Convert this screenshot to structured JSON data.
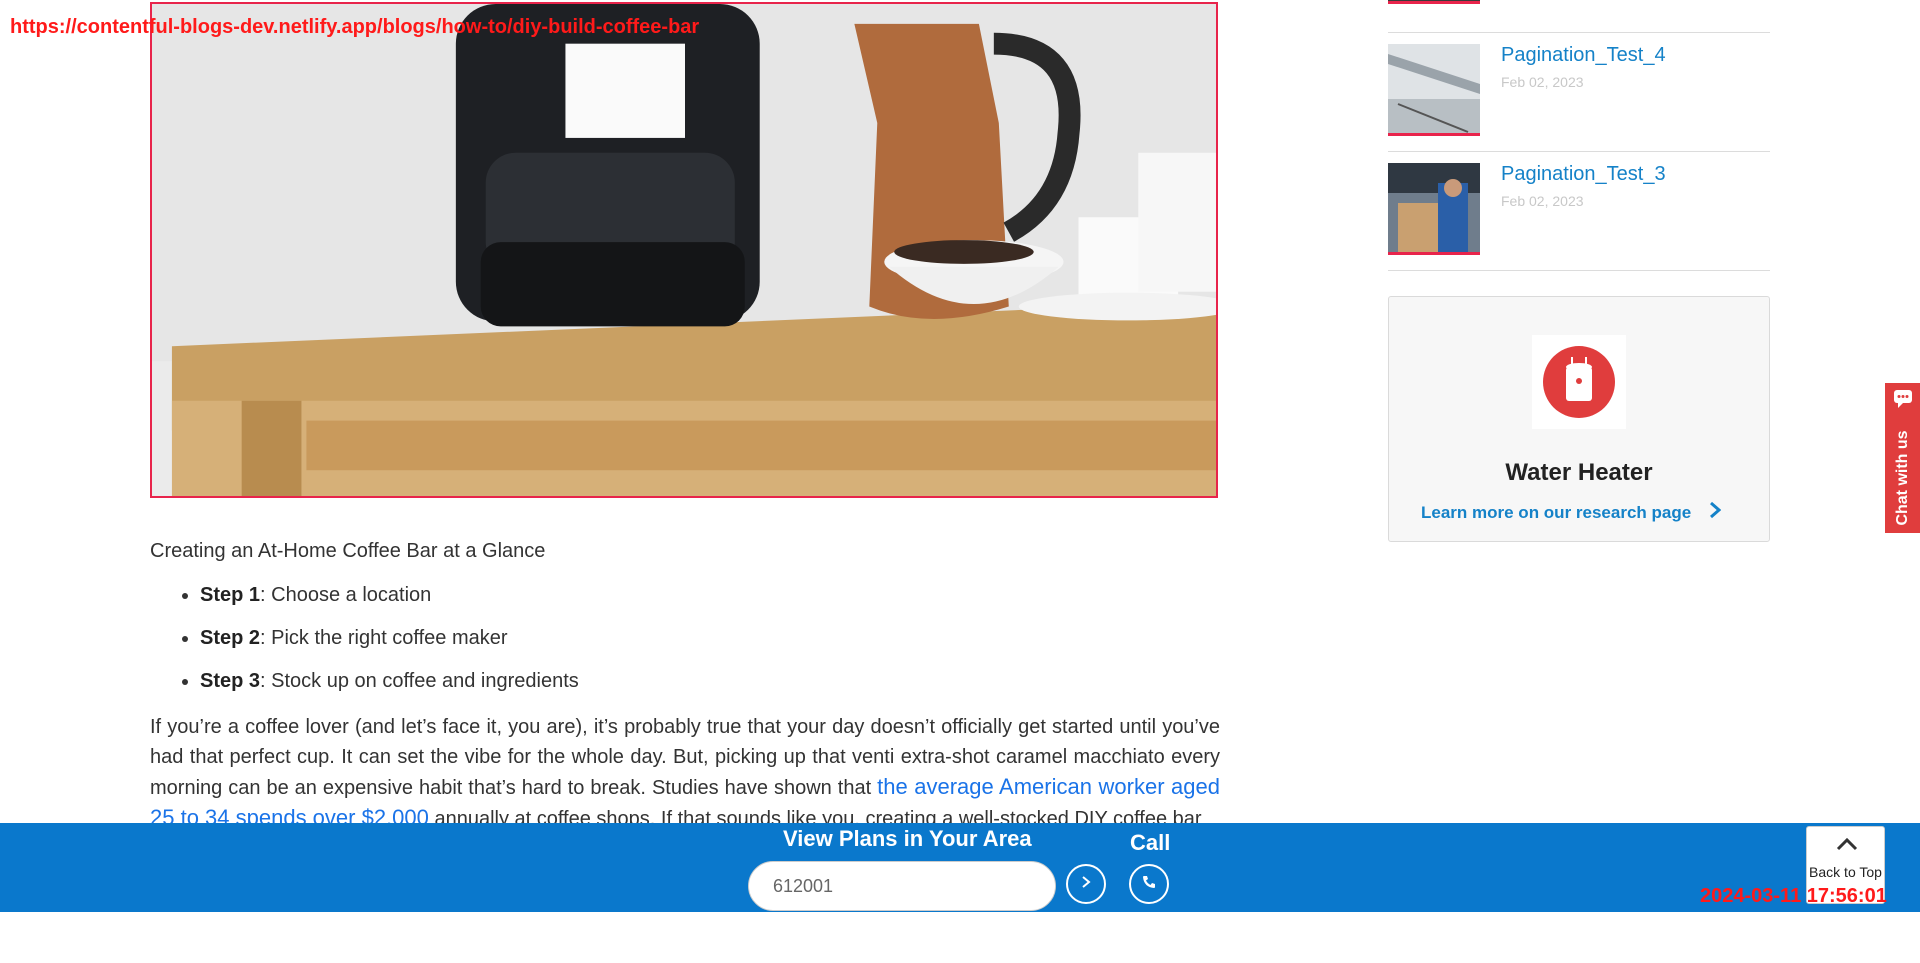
{
  "debug": {
    "url": "https://contentful-blogs-dev.netlify.app/blogs/how-to/diy-build-coffee-bar",
    "timestamp": "2024-03-11 17:56:01"
  },
  "hero": {
    "alt": "Coffee maker, copper pitcher and cups on a wooden table"
  },
  "article": {
    "glance_heading": "Creating an At-Home Coffee Bar at a Glance",
    "steps": [
      {
        "label": "Step 1",
        "text": ": Choose a location"
      },
      {
        "label": "Step 2",
        "text": ": Pick the right coffee maker"
      },
      {
        "label": "Step 3",
        "text": ": Stock up on coffee and ingredients"
      }
    ],
    "paragraph_start": "If you’re a coffee lover (and let’s face it, you are), it’s probably true that your day doesn’t officially get started until you’ve had that perfect cup. It can set the vibe for the whole day. But, picking up that venti extra-shot caramel macchiato every morning can be an expensive habit that’s hard to break. Studies have shown that ",
    "paragraph_link": "the average American worker aged 25 to 34 spends over $2,000",
    "paragraph_end": " annually at coffee shops. If that sounds like you, creating a well-stocked DIY coffee bar"
  },
  "sidebar": {
    "items": [
      {
        "title": "Pagination_Test_4",
        "date": "Feb 02, 2023"
      },
      {
        "title": "Pagination_Test_3",
        "date": "Feb 02, 2023"
      }
    ],
    "card": {
      "title": "Water Heater",
      "link": "Learn more on our research page",
      "icon": "water-heater-icon",
      "accent": "#e03d3d"
    }
  },
  "chat": {
    "label": "Chat with us"
  },
  "bottom_bar": {
    "title": "View Plans in Your Area",
    "zip_value": "612001",
    "call_label": "Call",
    "back_to_top": "Back to Top",
    "color": "#0a78cc"
  }
}
